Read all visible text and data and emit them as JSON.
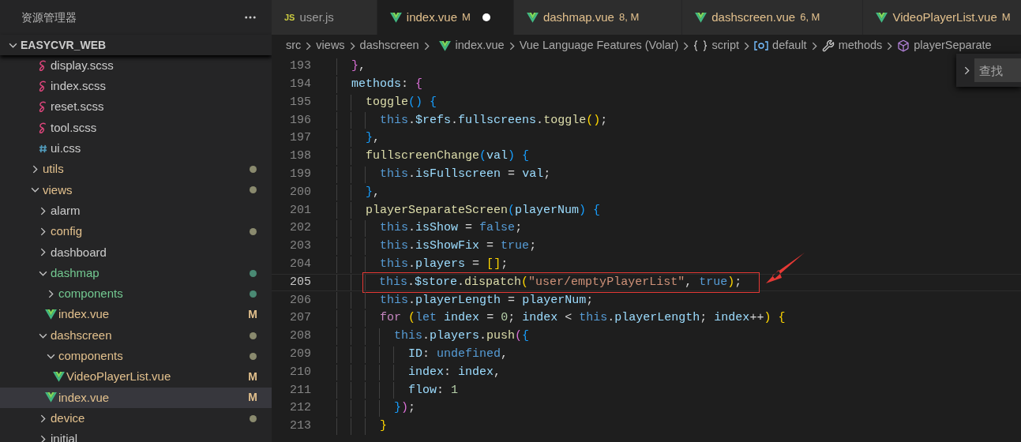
{
  "explorer": {
    "title": "资源管理器",
    "root": {
      "label": "EASYCVR_WEB",
      "kind": "folder",
      "expanded": true,
      "selected": false,
      "children": [
        {
          "kind": "group",
          "children": [
            {
              "label": "display.scss",
              "kind": "sass",
              "modified": false,
              "untracked": false,
              "selected": false
            },
            {
              "label": "index.scss",
              "kind": "sass",
              "modified": false,
              "untracked": false,
              "selected": false
            },
            {
              "label": "reset.scss",
              "kind": "sass",
              "modified": false,
              "untracked": false,
              "selected": false
            },
            {
              "label": "tool.scss",
              "kind": "sass",
              "modified": false,
              "untracked": false,
              "selected": false
            },
            {
              "label": "ui.css",
              "kind": "css",
              "modified": false,
              "untracked": false,
              "selected": false
            }
          ]
        },
        {
          "label": "utils",
          "kind": "folder",
          "expanded": false,
          "modified": true,
          "untracked": false,
          "color": "#8a8a6e",
          "selected": false
        },
        {
          "label": "views",
          "kind": "folder",
          "expanded": true,
          "modified": true,
          "untracked": false,
          "color": "#8a8a6e",
          "selected": false,
          "children": [
            {
              "label": "alarm",
              "kind": "folder",
              "expanded": false,
              "modified": false,
              "untracked": false,
              "selected": false
            },
            {
              "label": "config",
              "kind": "folder",
              "expanded": false,
              "modified": true,
              "untracked": false,
              "color": "#8a8a6e",
              "selected": false
            },
            {
              "label": "dashboard",
              "kind": "folder",
              "expanded": false,
              "modified": false,
              "untracked": false,
              "selected": false
            },
            {
              "label": "dashmap",
              "kind": "folder",
              "expanded": true,
              "untracked": true,
              "color": "#4a8a74",
              "selected": false,
              "children": [
                {
                  "label": "components",
                  "kind": "folder",
                  "expanded": false,
                  "untracked": true,
                  "color": "#4a8a74",
                  "selected": false
                },
                {
                  "label": "index.vue",
                  "kind": "vue",
                  "modified": true,
                  "untracked": false,
                  "badge": "M",
                  "selected": false
                }
              ]
            },
            {
              "label": "dashscreen",
              "kind": "folder",
              "expanded": true,
              "modified": true,
              "untracked": false,
              "color": "#8a8a6e",
              "selected": false,
              "children": [
                {
                  "label": "components",
                  "kind": "folder",
                  "expanded": true,
                  "modified": true,
                  "untracked": false,
                  "color": "#8a8a6e",
                  "selected": false,
                  "children": [
                    {
                      "label": "VideoPlayerList.vue",
                      "kind": "vue",
                      "modified": true,
                      "untracked": false,
                      "badge": "M",
                      "selected": false
                    }
                  ]
                },
                {
                  "label": "index.vue",
                  "kind": "vue",
                  "modified": true,
                  "untracked": false,
                  "badge": "M",
                  "selected": true
                }
              ]
            },
            {
              "label": "device",
              "kind": "folder",
              "expanded": false,
              "modified": true,
              "untracked": false,
              "color": "#8a8a6e",
              "selected": false
            },
            {
              "label": "initial",
              "kind": "folder",
              "expanded": false,
              "modified": false,
              "untracked": false,
              "selected": false
            }
          ]
        }
      ]
    }
  },
  "tabs": [
    {
      "label": "user.js",
      "kind": "js",
      "icon_label": "JS",
      "modified": false,
      "selected": false,
      "dirty": false
    },
    {
      "label": "index.vue",
      "kind": "vue",
      "modified": true,
      "badge": "M",
      "selected": true,
      "dirty": true
    },
    {
      "label": "dashmap.vue",
      "kind": "vue",
      "modified": true,
      "badge": "8, M",
      "selected": false,
      "dirty": false
    },
    {
      "label": "dashscreen.vue",
      "kind": "vue",
      "modified": true,
      "badge": "6, M",
      "selected": false,
      "dirty": false
    },
    {
      "label": "VideoPlayerList.vue",
      "kind": "vue",
      "modified": true,
      "badge": "M",
      "selected": false,
      "dirty": false
    }
  ],
  "breadcrumbs": [
    {
      "label": "src",
      "kind": "folder"
    },
    {
      "label": "views",
      "kind": "folder"
    },
    {
      "label": "dashscreen",
      "kind": "folder"
    },
    {
      "label": "index.vue",
      "kind": "vue"
    },
    {
      "label": "Vue Language Features (Volar)",
      "kind": "language"
    },
    {
      "label": "script",
      "kind": "block"
    },
    {
      "label": "default",
      "kind": "object"
    },
    {
      "label": "methods",
      "kind": "property"
    },
    {
      "label": "playerSeparate",
      "kind": "method"
    }
  ],
  "find_widget": {
    "placeholder": "查找"
  },
  "editor": {
    "lines": [
      {
        "number": "193",
        "current": false,
        "annotated": false,
        "text": "  },"
      },
      {
        "number": "194",
        "current": false,
        "annotated": false,
        "text": "  methods: {"
      },
      {
        "number": "195",
        "current": false,
        "annotated": false,
        "text": "    toggle() {"
      },
      {
        "number": "196",
        "current": false,
        "annotated": false,
        "text": "      this.$refs.fullscreens.toggle();"
      },
      {
        "number": "197",
        "current": false,
        "annotated": false,
        "text": "    },"
      },
      {
        "number": "198",
        "current": false,
        "annotated": false,
        "text": "    fullscreenChange(val) {"
      },
      {
        "number": "199",
        "current": false,
        "annotated": false,
        "text": "      this.isFullscreen = val;"
      },
      {
        "number": "200",
        "current": false,
        "annotated": false,
        "text": "    },"
      },
      {
        "number": "201",
        "current": false,
        "annotated": false,
        "text": "    playerSeparateScreen(playerNum) {"
      },
      {
        "number": "202",
        "current": false,
        "annotated": false,
        "text": "      this.isShow = false;"
      },
      {
        "number": "203",
        "current": false,
        "annotated": false,
        "text": "      this.isShowFix = true;"
      },
      {
        "number": "204",
        "current": false,
        "annotated": false,
        "text": "      this.players = [];"
      },
      {
        "number": "205",
        "current": true,
        "annotated": true,
        "text": "      this.$store.dispatch(\"user/emptyPlayerList\", true);"
      },
      {
        "number": "206",
        "current": false,
        "annotated": false,
        "text": "      this.playerLength = playerNum;"
      },
      {
        "number": "207",
        "current": false,
        "annotated": false,
        "text": "      for (let index = 0; index < this.playerLength; index++) {"
      },
      {
        "number": "208",
        "current": false,
        "annotated": false,
        "text": "        this.players.push({"
      },
      {
        "number": "209",
        "current": false,
        "annotated": false,
        "text": "          ID: undefined,"
      },
      {
        "number": "210",
        "current": false,
        "annotated": false,
        "text": "          index: index,"
      },
      {
        "number": "211",
        "current": false,
        "annotated": false,
        "text": "          flow: 1"
      },
      {
        "number": "212",
        "current": false,
        "annotated": false,
        "text": "        });"
      },
      {
        "number": "213",
        "current": false,
        "annotated": false,
        "text": "      }"
      }
    ]
  }
}
